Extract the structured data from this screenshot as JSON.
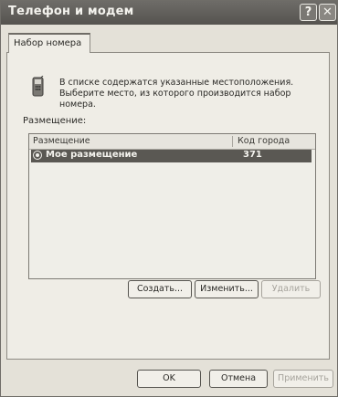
{
  "window": {
    "title": "Телефон и модем",
    "help_symbol": "?",
    "close_symbol": "✕"
  },
  "tabs": [
    {
      "label": "Набор номера",
      "selected": true
    }
  ],
  "dialing": {
    "description_line1": "В списке содержатся указанные местоположения.",
    "description_line2": "Выберите место, из которого производится набор номера.",
    "icon": "phone-icon",
    "section_label": "Размещение:"
  },
  "locations_table": {
    "columns": [
      "Размещение",
      "Код города"
    ],
    "rows": [
      {
        "name": "Мое размещение",
        "area_code": "371",
        "selected": true
      }
    ]
  },
  "list_buttons": {
    "create": "Создать...",
    "edit": "Изменить...",
    "delete": "Удалить"
  },
  "dialog_buttons": {
    "ok": "OK",
    "cancel": "Отмена",
    "apply": "Применить"
  }
}
